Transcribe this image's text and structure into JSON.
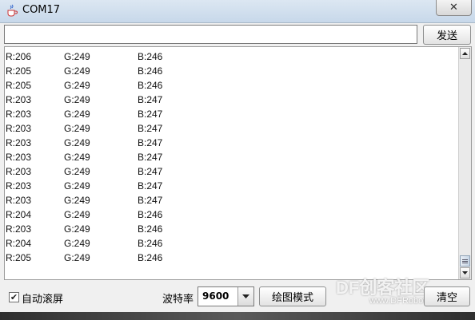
{
  "window": {
    "title": "COM17",
    "close_glyph": "✕",
    "app_icon": "java-cup-icon"
  },
  "send": {
    "input_value": "",
    "placeholder": "",
    "button_label": "发送"
  },
  "output": {
    "lines": [
      {
        "r": "R:206",
        "g": "G:249",
        "b": "B:246"
      },
      {
        "r": "R:205",
        "g": "G:249",
        "b": "B:246"
      },
      {
        "r": "R:205",
        "g": "G:249",
        "b": "B:246"
      },
      {
        "r": "R:203",
        "g": "G:249",
        "b": "B:247"
      },
      {
        "r": "R:203",
        "g": "G:249",
        "b": "B:247"
      },
      {
        "r": "R:203",
        "g": "G:249",
        "b": "B:247"
      },
      {
        "r": "R:203",
        "g": "G:249",
        "b": "B:247"
      },
      {
        "r": "R:203",
        "g": "G:249",
        "b": "B:247"
      },
      {
        "r": "R:203",
        "g": "G:249",
        "b": "B:247"
      },
      {
        "r": "R:203",
        "g": "G:249",
        "b": "B:247"
      },
      {
        "r": "R:203",
        "g": "G:249",
        "b": "B:247"
      },
      {
        "r": "R:204",
        "g": "G:249",
        "b": "B:246"
      },
      {
        "r": "R:203",
        "g": "G:249",
        "b": "B:246"
      },
      {
        "r": "R:204",
        "g": "G:249",
        "b": "B:246"
      },
      {
        "r": "R:205",
        "g": "G:249",
        "b": "B:246"
      }
    ]
  },
  "footer": {
    "autoscroll_label": "自动滚屏",
    "autoscroll_checked": true,
    "baud_label": "波特率",
    "baud_value": "9600",
    "plot_button_label": "绘图模式",
    "clear_button_label": "清空"
  },
  "watermark": {
    "brand": "DF创客社区",
    "url": "www.DFRobot.com.cn"
  }
}
